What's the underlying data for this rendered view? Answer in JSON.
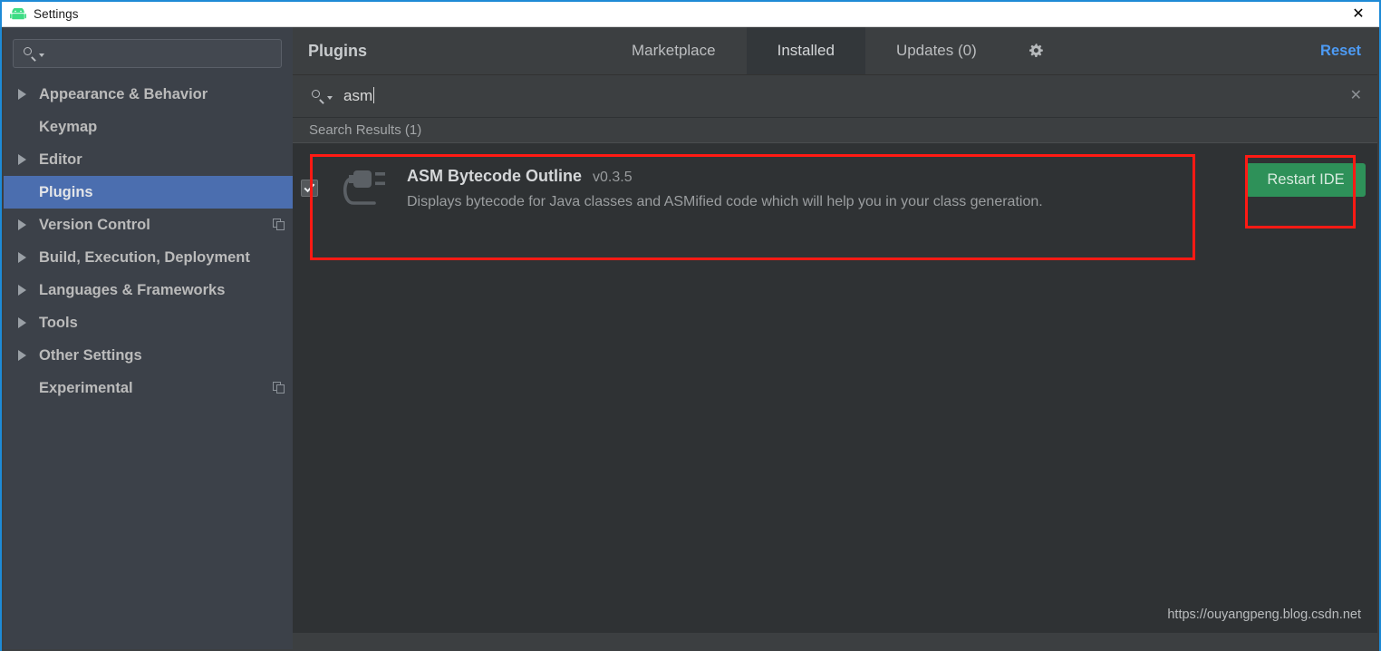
{
  "window": {
    "title": "Settings",
    "app_icon": "android-robot-icon",
    "close_label": "✕",
    "border_color": "#1e8ad6"
  },
  "sidebar": {
    "search": {
      "placeholder": "",
      "value": "",
      "icon": "search-icon"
    },
    "items": [
      {
        "label": "Appearance & Behavior",
        "expandable": true,
        "badge": false,
        "selected": false
      },
      {
        "label": "Keymap",
        "expandable": false,
        "badge": false,
        "selected": false
      },
      {
        "label": "Editor",
        "expandable": true,
        "badge": false,
        "selected": false
      },
      {
        "label": "Plugins",
        "expandable": false,
        "badge": false,
        "selected": true
      },
      {
        "label": "Version Control",
        "expandable": true,
        "badge": true,
        "selected": false
      },
      {
        "label": "Build, Execution, Deployment",
        "expandable": true,
        "badge": false,
        "selected": false
      },
      {
        "label": "Languages & Frameworks",
        "expandable": true,
        "badge": false,
        "selected": false
      },
      {
        "label": "Tools",
        "expandable": true,
        "badge": false,
        "selected": false
      },
      {
        "label": "Other Settings",
        "expandable": true,
        "badge": false,
        "selected": false
      },
      {
        "label": "Experimental",
        "expandable": false,
        "badge": true,
        "selected": false
      }
    ]
  },
  "main": {
    "panel_title": "Plugins",
    "tabs": [
      {
        "label": "Marketplace",
        "active": false
      },
      {
        "label": "Installed",
        "active": true
      },
      {
        "label": "Updates (0)",
        "active": false
      }
    ],
    "gear_icon": "gear-icon",
    "reset_label": "Reset",
    "reset_color": "#4d9bf5",
    "search": {
      "value": "asm",
      "placeholder": "",
      "icon": "search-icon",
      "clear_icon": "✕"
    },
    "results_header": "Search Results (1)",
    "plugins": [
      {
        "name": "ASM Bytecode Outline",
        "version": "v0.3.5",
        "description": "Displays bytecode for Java classes and ASMified code which will help you in your class generation.",
        "enabled": true,
        "icon": "plugin-plug-icon"
      }
    ],
    "restart_button": {
      "label": "Restart IDE",
      "color": "#2e9159"
    }
  },
  "annotations": {
    "color": "#ff1a14",
    "boxes": [
      {
        "name": "plugin-row-highlight"
      },
      {
        "name": "restart-ide-highlight"
      }
    ]
  },
  "watermark": "https://ouyangpeng.blog.csdn.net"
}
